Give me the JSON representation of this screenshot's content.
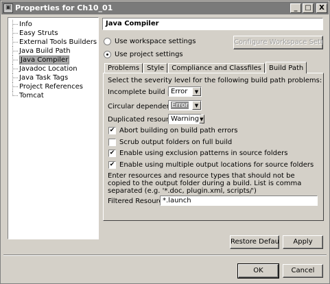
{
  "window": {
    "title": "Properties for Ch10_01",
    "minimize": "_",
    "maximize": "□",
    "close": "X"
  },
  "tree": {
    "items": [
      {
        "label": "Info"
      },
      {
        "label": "Easy Struts"
      },
      {
        "label": "External Tools Builders"
      },
      {
        "label": "Java Build Path"
      },
      {
        "label": "Java Compiler"
      },
      {
        "label": "Javadoc Location"
      },
      {
        "label": "Java Task Tags"
      },
      {
        "label": "Project References"
      },
      {
        "label": "Tomcat"
      }
    ],
    "selected": "Java Compiler"
  },
  "page": {
    "title": "Java Compiler",
    "use_workspace_label": "Use workspace settings",
    "configure_workspace_label": "Configure Workspace Settings...",
    "use_project_label": "Use project settings",
    "selected_radio": "project"
  },
  "tabs": [
    {
      "label": "Problems"
    },
    {
      "label": "Style"
    },
    {
      "label": "Compliance and Classfiles"
    },
    {
      "label": "Build Path"
    }
  ],
  "active_tab": "Build Path",
  "build_path": {
    "intro": "Select the severity level for the following build path problems:",
    "incomplete_label": "Incomplete build path:",
    "incomplete_value": "Error",
    "circular_label": "Circular dependencies:",
    "circular_value": "Error",
    "duplicated_label": "Duplicated resources:",
    "duplicated_value": "Warning",
    "checks": [
      {
        "label": "Abort building on build path errors",
        "checked": true
      },
      {
        "label": "Scrub output folders on full build",
        "checked": false
      },
      {
        "label": "Enable using exclusion patterns in source folders",
        "checked": true
      },
      {
        "label": "Enable using multiple output locations for source folders",
        "checked": true
      }
    ],
    "check_mark": "✔",
    "resources_desc": "Enter resources and resource types that should not be copied to the output folder during a build. List is comma separated (e.g. '*.doc, plugin.xml, scripts/')",
    "filtered_label": "Filtered Resources:",
    "filtered_value": "*.launch"
  },
  "buttons": {
    "restore_defaults": "Restore Defaults",
    "apply": "Apply",
    "ok": "OK",
    "cancel": "Cancel"
  },
  "icons": {
    "app": "properties-icon",
    "combo_arrow": "▼"
  },
  "colors": {
    "titlebar": "#7a7a7a",
    "face": "#d4d0c8",
    "selection": "#a8a8a8"
  }
}
